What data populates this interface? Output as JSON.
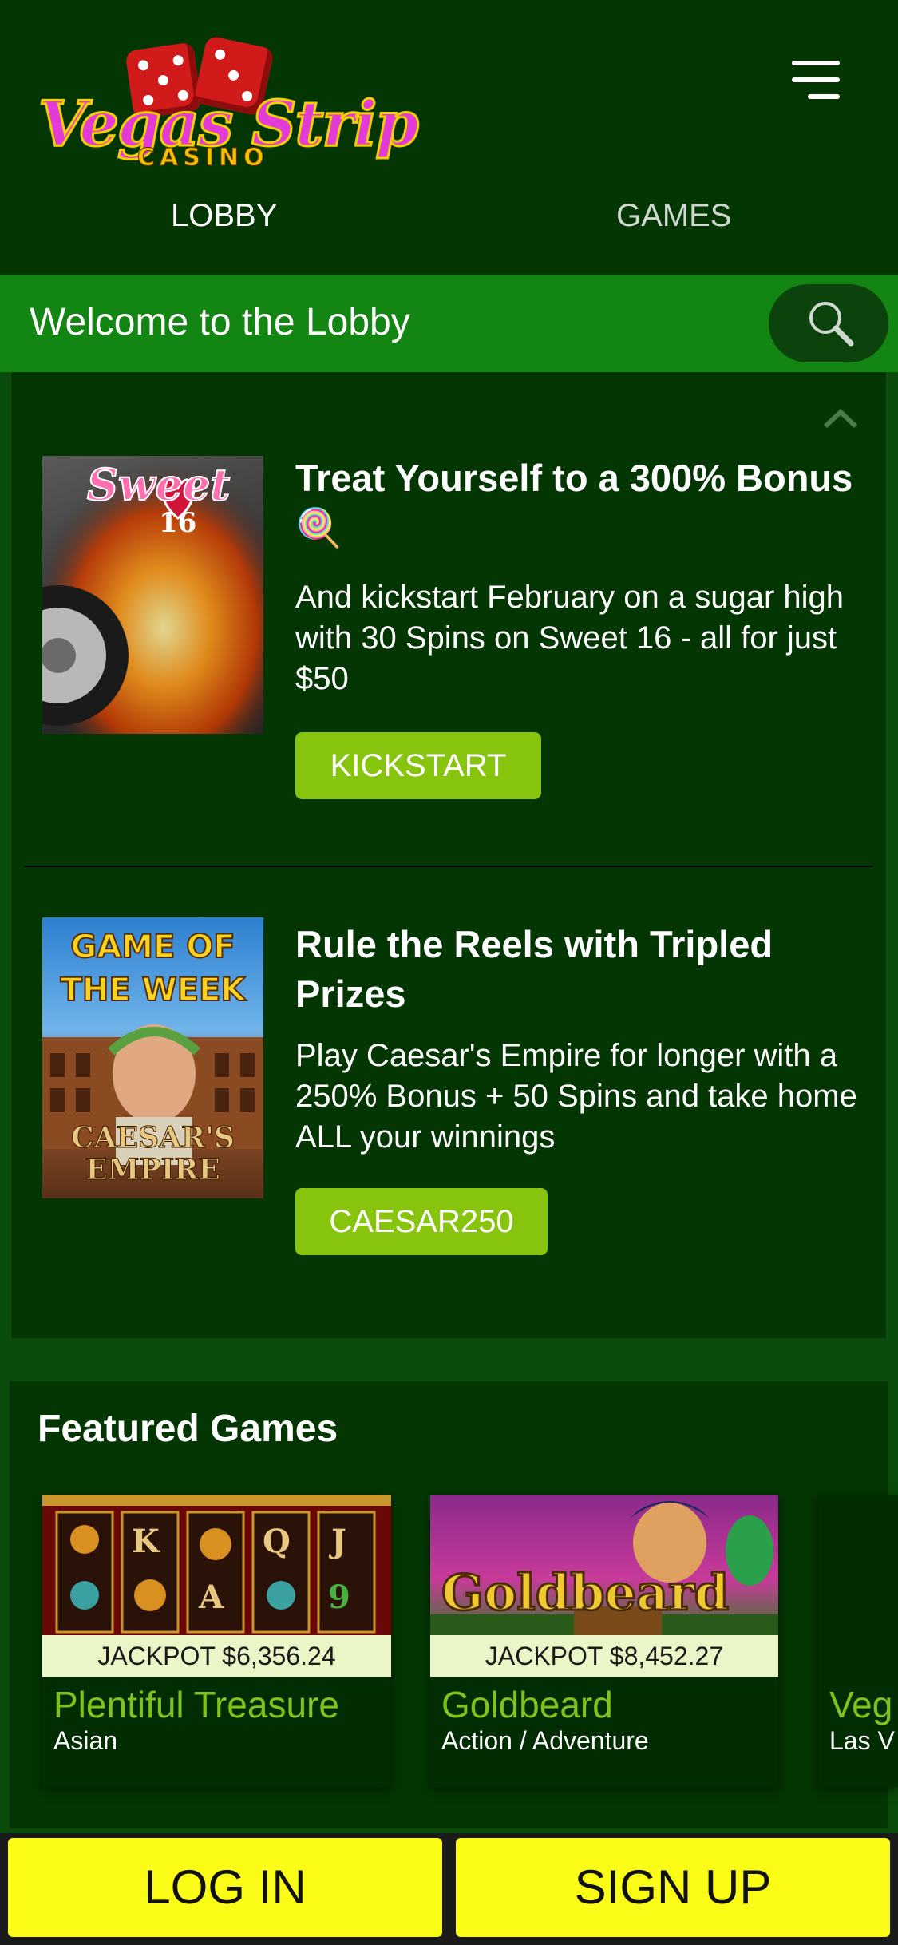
{
  "header": {
    "logo_text": "Vegas Strip",
    "logo_sub": "CASINO",
    "nav": [
      {
        "label": "LOBBY"
      },
      {
        "label": "GAMES"
      }
    ]
  },
  "lobby": {
    "title": "Welcome to the Lobby"
  },
  "promos": [
    {
      "image_title": "Sweet",
      "image_number": "16",
      "title": "Treat Yourself to a 300% Bonus",
      "emoji": "🍭",
      "body": "And kickstart February on a sugar high with 30 Spins on Sweet 16 - all for just $50",
      "button": "KICKSTART"
    },
    {
      "image_top": "GAME OF THE WEEK",
      "image_bottom": "CAESAR'S EMPIRE",
      "title": "Rule the Reels with Tripled Prizes",
      "body": "Play Caesar's Empire for longer with a 250% Bonus + 50 Spins and take home ALL your winnings",
      "button": "CAESAR250"
    }
  ],
  "featured": {
    "title": "Featured Games",
    "games": [
      {
        "jackpot": "JACKPOT $6,356.24",
        "name": "Plentiful Treasure",
        "category": "Asian"
      },
      {
        "jackpot": "JACKPOT $8,452.27",
        "name": "Goldbeard",
        "category": "Action / Adventure",
        "thumb_text": "Goldbeard"
      },
      {
        "name": "Veg",
        "category": "Las V"
      }
    ]
  },
  "bottom": {
    "login": "LOG IN",
    "signup": "SIGN UP"
  },
  "colors": {
    "header_bg": "#033603",
    "lobby_bar": "#138513",
    "button_green": "#87c40e",
    "bottom_yellow": "#fbfb18",
    "game_name_green": "#7ec41a"
  }
}
